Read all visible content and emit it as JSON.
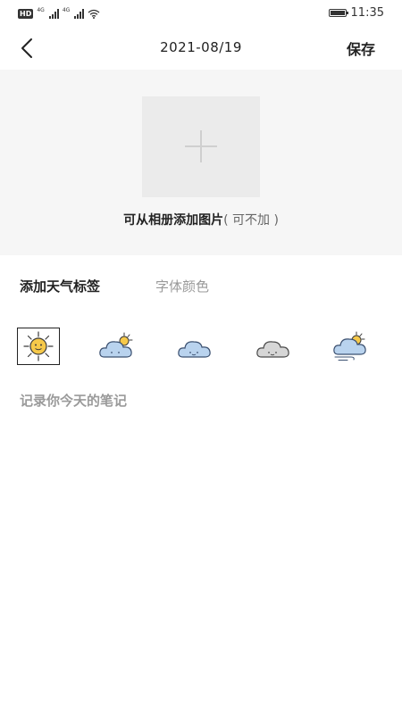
{
  "status_bar": {
    "left_badge": "HD",
    "sig1_label": "4G",
    "sig2_label": "4G",
    "time": "11:35"
  },
  "header": {
    "date": "2021-08/19",
    "save_label": "保存"
  },
  "photo": {
    "caption_main": "可从相册添加图片",
    "caption_optional": "( 可不加 )"
  },
  "tabs": [
    {
      "label": "添加天气标签",
      "active": true
    },
    {
      "label": "字体颜色",
      "active": false
    }
  ],
  "weather_icons": [
    {
      "name": "sun-icon",
      "selected": true
    },
    {
      "name": "partly-cloudy-icon",
      "selected": false
    },
    {
      "name": "cloud-icon",
      "selected": false
    },
    {
      "name": "overcast-cloud-icon",
      "selected": false
    },
    {
      "name": "windy-cloud-sun-icon",
      "selected": false
    }
  ],
  "note": {
    "placeholder": "记录你今天的笔记"
  },
  "colors": {
    "sun_yellow": "#f6c94a",
    "cloud_blue": "#b9d3ee",
    "cloud_gray": "#d6d6d6",
    "outline": "#3b5070"
  }
}
